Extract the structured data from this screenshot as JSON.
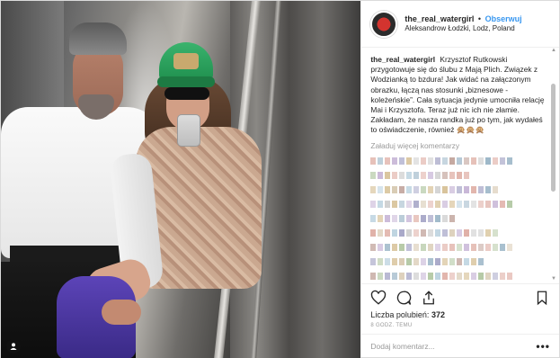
{
  "header": {
    "username": "the_real_watergirl",
    "separator": "•",
    "follow_label": "Obserwuj",
    "location": "Aleksandrow Łodzki, Lodz, Poland"
  },
  "caption": {
    "username": "the_real_watergirl",
    "text": "Krzysztof Rutkowski przygotowuje się do ślubu z Mają Plich. Związek z Wodzianką to bzdura! Jak widać na załączonym obrazku, łączą nas stosunki „biznesowe - koleżeńskie”. Cała sytuacja jedynie umocniła relację Mai i Krzysztofa. Teraz już nic ich nie złamie. Zakładam, że nasza randka już po tym, jak wydałeś to oświadczenie, również 🙊🙊🙊"
  },
  "comments": {
    "load_more": "Załaduj więcej komentarzy"
  },
  "actions": {
    "like_icon": "heart-icon",
    "comment_icon": "comment-icon",
    "share_icon": "share-icon",
    "save_icon": "bookmark-icon"
  },
  "likes": {
    "label": "Liczba polubień:",
    "count": "372"
  },
  "timestamp": "8 GODZ. TEMU",
  "add_comment": {
    "placeholder": "Dodaj komentarz...",
    "more_label": "•••"
  },
  "colors": {
    "link": "#3897f0",
    "text": "#262626",
    "muted": "#999999"
  }
}
